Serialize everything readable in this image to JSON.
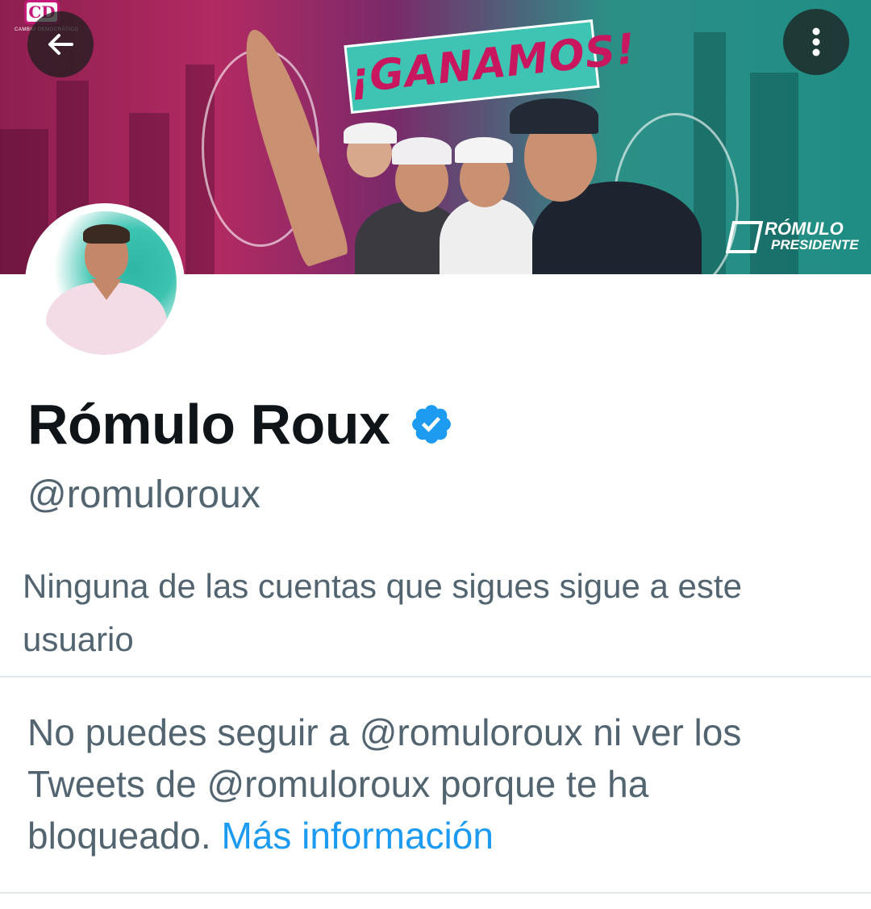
{
  "banner": {
    "party_logo_text": "CD",
    "party_logo_caption": "CAMBIO DEMOCRÁTICO",
    "headline": "¡GANAMOS!",
    "campaign_logo_line1": "RÓMULO",
    "campaign_logo_line2": "PRESIDENTE"
  },
  "profile": {
    "name": "Rómulo Roux",
    "handle": "@romuloroux",
    "mutual_followers_text": "Ninguna de las cuentas que sigues sigue a este usuario"
  },
  "blocked_notice": {
    "text": "No puedes seguir a @romuloroux ni ver los Tweets de @romuloroux porque te ha bloqueado. ",
    "link_label": "Más información"
  },
  "icons": {
    "back": "arrow-left-icon",
    "more": "more-vertical-icon",
    "verified": "verified-badge-icon"
  },
  "colors": {
    "link": "#1d9bf0",
    "secondary_text": "#536471",
    "primary_text": "#0f1419",
    "verified": "#1d9bf0"
  }
}
